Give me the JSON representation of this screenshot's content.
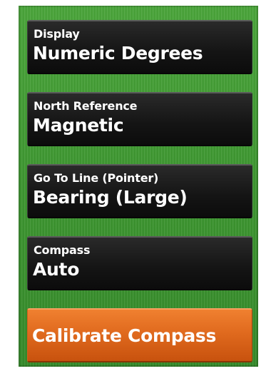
{
  "settings": [
    {
      "label": "Display",
      "value": "Numeric Degrees"
    },
    {
      "label": "North Reference",
      "value": "Magnetic"
    },
    {
      "label": "Go To Line (Pointer)",
      "value": "Bearing (Large)"
    },
    {
      "label": "Compass",
      "value": "Auto"
    }
  ],
  "action": {
    "label": "Calibrate Compass"
  },
  "colors": {
    "panel_green": "#3d9630",
    "setting_background": "#141414",
    "action_orange": "#e06a1e",
    "text": "#ffffff"
  }
}
